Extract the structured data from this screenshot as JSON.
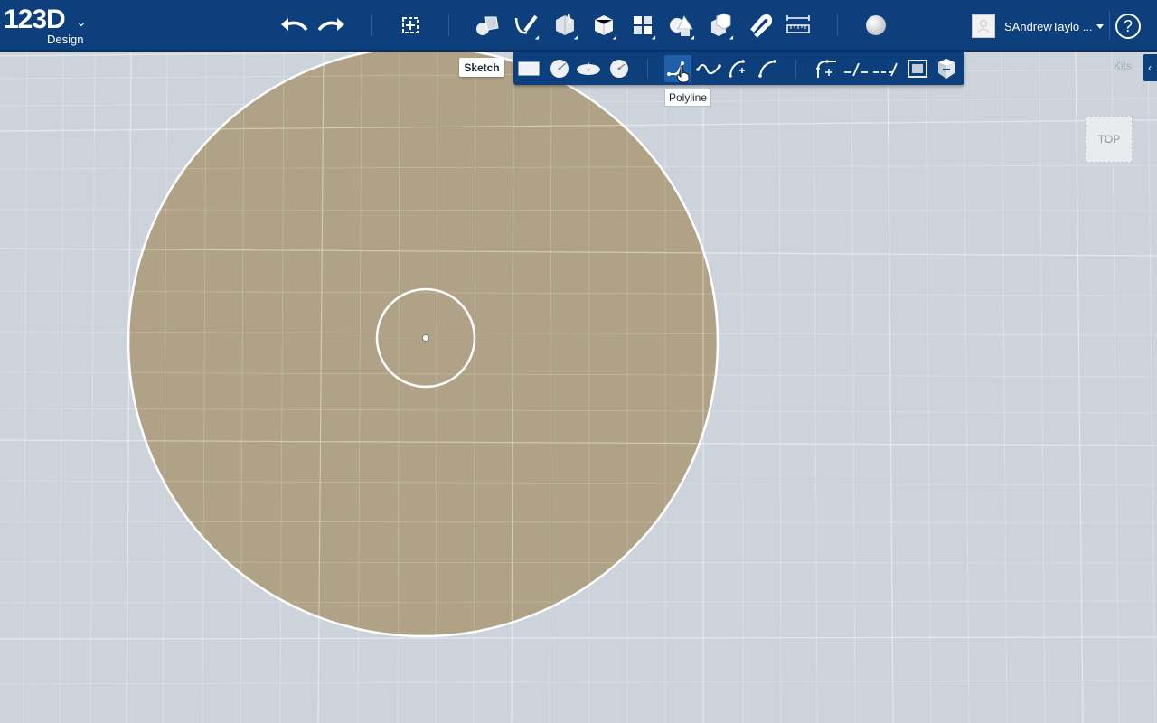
{
  "app": {
    "logo_number": "123D",
    "logo_sub": "Design"
  },
  "toolbar": {
    "undo_icon": "undo-icon",
    "redo_icon": "redo-icon",
    "buttons": [
      "transform",
      "primitives",
      "sketch",
      "construct",
      "modify",
      "pattern",
      "grouping",
      "combine",
      "snap",
      "measure",
      "material"
    ]
  },
  "user": {
    "name": "SAndrewTaylo ..."
  },
  "help": {
    "label": "?"
  },
  "sketch_menu": {
    "label": "Sketch",
    "tooltip": "Polyline",
    "tools": [
      "rectangle",
      "circle",
      "ellipse",
      "polygon",
      "polyline",
      "spline",
      "two-point-arc",
      "three-point-arc",
      "fillet",
      "trim",
      "extend",
      "offset",
      "project"
    ],
    "active_tool": "polyline"
  },
  "kits": {
    "label": "Kits",
    "tab_glyph": "‹"
  },
  "viewcube": {
    "label": "TOP"
  },
  "colors": {
    "toolbar_bg": "#0d3f7c",
    "canvas_bg": "#ccd3db",
    "sketch_fill": "#ad9f83"
  }
}
